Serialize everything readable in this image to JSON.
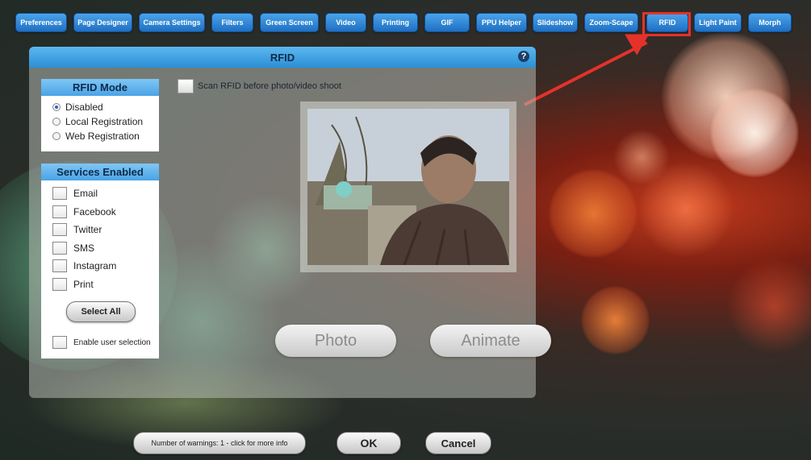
{
  "topnav": {
    "items": [
      {
        "label": "Preferences"
      },
      {
        "label": "Page Designer"
      },
      {
        "label": "Camera Settings"
      },
      {
        "label": "Filters"
      },
      {
        "label": "Green Screen"
      },
      {
        "label": "Video"
      },
      {
        "label": "Printing"
      },
      {
        "label": "GIF"
      },
      {
        "label": "PPU Helper"
      },
      {
        "label": "Slideshow"
      },
      {
        "label": "Zoom-Scape"
      },
      {
        "label": "RFID"
      },
      {
        "label": "Light Paint"
      },
      {
        "label": "Morph"
      }
    ],
    "active": "RFID",
    "highlight_color": "#e4322b"
  },
  "panel": {
    "title": "RFID",
    "help_icon": "question-circle-icon",
    "mode_box": {
      "title": "RFID Mode",
      "options": [
        {
          "label": "Disabled",
          "selected": true
        },
        {
          "label": "Local Registration",
          "selected": false
        },
        {
          "label": "Web Registration",
          "selected": false
        }
      ]
    },
    "services_box": {
      "title": "Services Enabled",
      "items": [
        {
          "label": "Email",
          "checked": false
        },
        {
          "label": "Facebook",
          "checked": false
        },
        {
          "label": "Twitter",
          "checked": false
        },
        {
          "label": "SMS",
          "checked": false
        },
        {
          "label": "Instagram",
          "checked": false
        },
        {
          "label": "Print",
          "checked": false
        }
      ],
      "select_all_label": "Select All",
      "enable_user_selection_label": "Enable user selection"
    },
    "scan_label": "Scan RFID before photo/video shoot",
    "photo_button": "Photo",
    "animate_button": "Animate"
  },
  "footer": {
    "warnings_label": "Number of warnings: 1 - click for more info",
    "ok_label": "OK",
    "cancel_label": "Cancel"
  },
  "colors": {
    "nav_button": "#2f86d6",
    "panel_header": "#3fa0e0",
    "annotation": "#e4322b"
  }
}
